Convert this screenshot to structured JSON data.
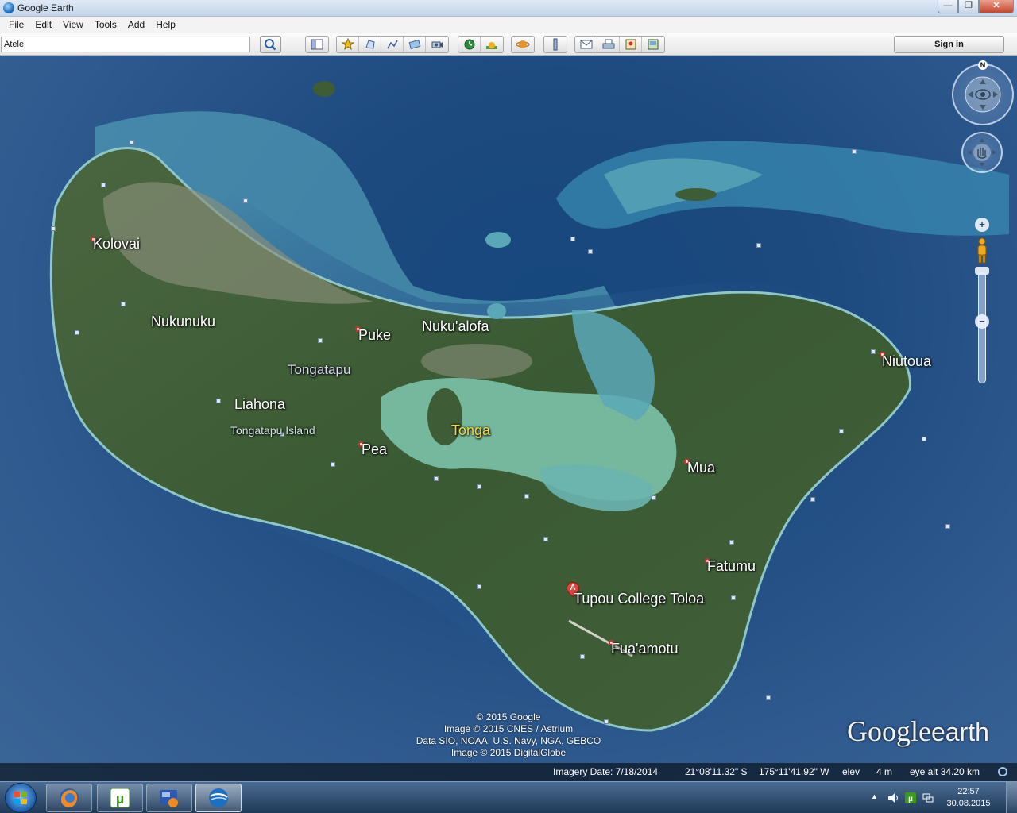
{
  "window": {
    "title": "Google Earth",
    "minimize": "—",
    "maximize": "❐",
    "close": "✕"
  },
  "menu": [
    "File",
    "Edit",
    "View",
    "Tools",
    "Add",
    "Help"
  ],
  "search": {
    "value": "Atele"
  },
  "toolbar": {
    "signin_label": "Sign in"
  },
  "map": {
    "compass_north": "N",
    "zoom_in": "+",
    "zoom_out": "−",
    "places": {
      "kolovai": "Kolovai",
      "nukunuku": "Nukunuku",
      "puke": "Puke",
      "nukualofa": "Nuku'alofa",
      "tongatapu": "Tongatapu",
      "liahona": "Liahona",
      "tongatapu_island": "Tongatapu Island",
      "tonga": "Tonga",
      "pea": "Pea",
      "niutoua": "Niutoua",
      "mua": "Mua",
      "fatumu": "Fatumu",
      "tupou_college": "Tupou College Toloa",
      "fuaamotu": "Fua'amotu"
    },
    "pin_label": "A",
    "attribution": [
      "© 2015 Google",
      "Image © 2015 CNES / Astrium",
      "Data SIO, NOAA, U.S. Navy, NGA, GEBCO",
      "Image © 2015 DigitalGlobe"
    ],
    "logo_google": "Google",
    "logo_earth": "earth"
  },
  "status": {
    "imagery_date": "Imagery Date: 7/18/2014",
    "latitude": "21°08'11.32\" S",
    "longitude": "175°11'41.92\" W",
    "elev_label": "elev",
    "elev_value": "4 m",
    "eye_alt": "eye alt  34.20 km"
  },
  "taskbar": {
    "time": "22:57",
    "date": "30.08.2015",
    "tray_arrow": "▲"
  },
  "colors": {
    "ocean": "#1d4a7f",
    "land": "#3b5a34",
    "reef": "#6fb7c8",
    "lagoon": "#7fc6ae",
    "pin": "#e0433c"
  }
}
